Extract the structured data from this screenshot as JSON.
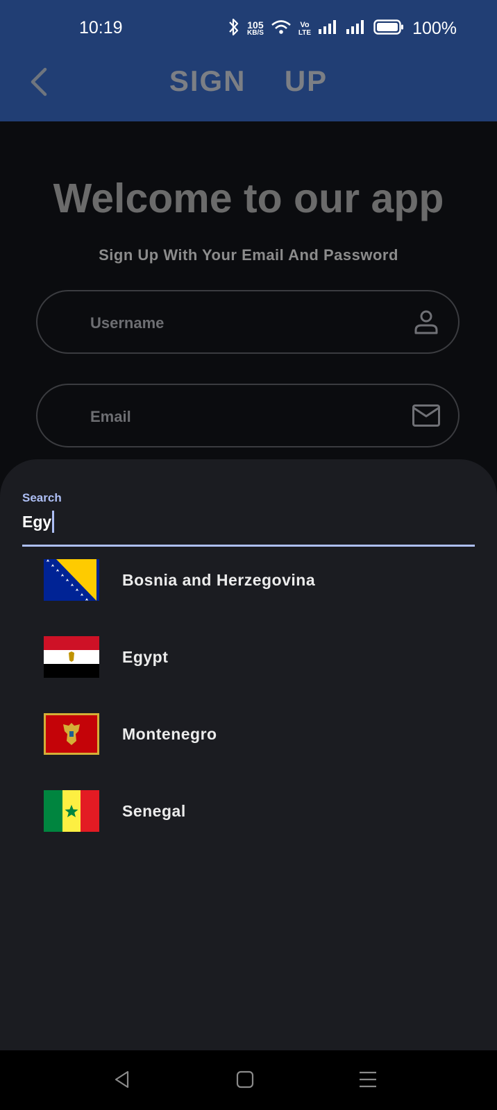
{
  "status_bar": {
    "time": "10:19",
    "net_speed_value": "105",
    "net_speed_unit": "KB/S",
    "volte": "Vo",
    "lte": "LTE",
    "battery": "100%",
    "icons": [
      "bluetooth-icon",
      "wifi-icon",
      "volte-icon",
      "signal-icon",
      "signal-icon",
      "battery-icon"
    ]
  },
  "app_bar": {
    "title": "SIGN  UP",
    "back_icon": "chevron-left-icon"
  },
  "form": {
    "welcome": "Welcome to our app",
    "subtitle": "Sign Up With Your Email And Password",
    "username_placeholder": "Username",
    "email_placeholder": "Email",
    "username_icon": "person-icon",
    "email_icon": "mail-icon"
  },
  "country_picker": {
    "search_label": "Search",
    "search_value": "Egy",
    "countries": [
      {
        "name": "Bosnia and Herzegovina",
        "flag": "flag-bosnia-and-herzegovina"
      },
      {
        "name": "Egypt",
        "flag": "flag-egypt"
      },
      {
        "name": "Montenegro",
        "flag": "flag-montenegro"
      },
      {
        "name": "Senegal",
        "flag": "flag-senegal"
      }
    ]
  },
  "nav_bar": {
    "icons": [
      "back-triangle-icon",
      "home-square-icon",
      "menu-lines-icon"
    ]
  },
  "colors": {
    "app_bar": "#213e74",
    "background": "#0b0c0f",
    "sheet": "#1b1c21",
    "accent": "#aebff5"
  }
}
